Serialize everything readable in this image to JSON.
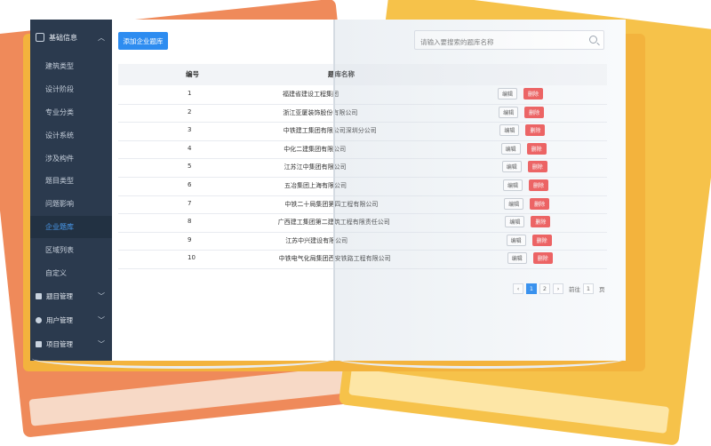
{
  "sidebar": {
    "header": {
      "label": "基础信息",
      "icon": "document-icon"
    },
    "items": [
      {
        "label": "建筑类型"
      },
      {
        "label": "设计阶段"
      },
      {
        "label": "专业分类"
      },
      {
        "label": "设计系统"
      },
      {
        "label": "涉及构件"
      },
      {
        "label": "题目类型"
      },
      {
        "label": "问题影响"
      },
      {
        "label": "企业题库",
        "active": true
      },
      {
        "label": "区域列表"
      },
      {
        "label": "自定义"
      }
    ],
    "groups": [
      {
        "label": "题目管理",
        "icon": "list-icon"
      },
      {
        "label": "用户管理",
        "icon": "user-icon"
      },
      {
        "label": "项目管理",
        "icon": "grid-icon"
      }
    ]
  },
  "toolbar": {
    "add_label": "添加企业题库"
  },
  "search": {
    "placeholder": "请输入要搜索的题库名称"
  },
  "table": {
    "columns": [
      "编号",
      "题库名称"
    ],
    "rows": [
      {
        "num": "1",
        "name": "福建省建设工程集团"
      },
      {
        "num": "2",
        "name": "浙江亚厦装饰股份有限公司"
      },
      {
        "num": "3",
        "name": "中铁建工集团有限公司深圳分公司"
      },
      {
        "num": "4",
        "name": "中化二建集团有限公司"
      },
      {
        "num": "5",
        "name": "江苏江中集团有限公司"
      },
      {
        "num": "6",
        "name": "五冶集团上海有限公司"
      },
      {
        "num": "7",
        "name": "中铁二十局集团第四工程有限公司"
      },
      {
        "num": "8",
        "name": "广西建工集团第二建筑工程有限责任公司"
      },
      {
        "num": "9",
        "name": "江苏中兴建设有限公司"
      },
      {
        "num": "10",
        "name": "中铁电气化局集团西安铁路工程有限公司"
      }
    ],
    "edit_label": "编辑",
    "delete_label": "删除"
  },
  "pagination": {
    "prev": "‹",
    "pages": [
      "1",
      "2"
    ],
    "current": "1",
    "next": "›",
    "goto_label": "前往",
    "goto_value": "1",
    "page_unit": "页"
  },
  "colors": {
    "accent": "#2d8cf0",
    "danger": "#ef5b5b",
    "sidebar": "#2b3a4e",
    "book_orange": "#ef8a5a",
    "book_yellow": "#f6c24a",
    "book_main": "#f3b33d"
  }
}
